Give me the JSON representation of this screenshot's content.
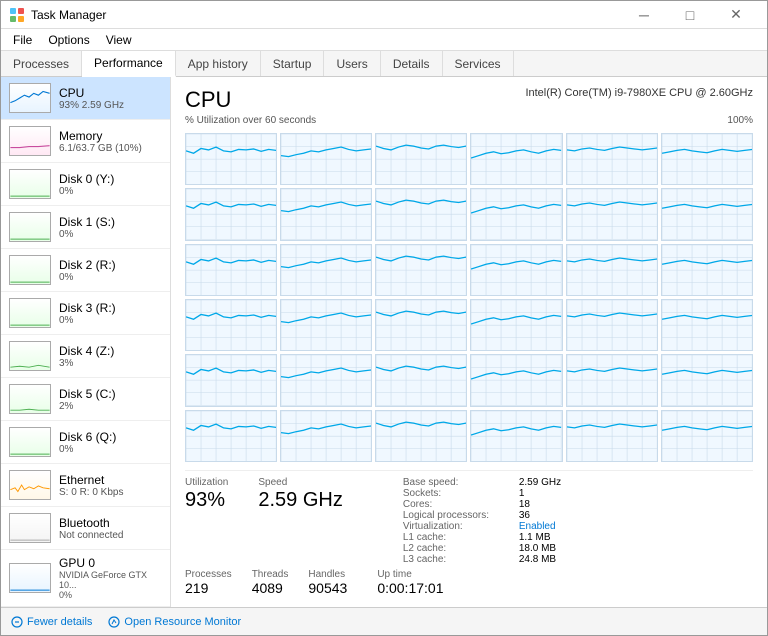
{
  "window": {
    "title": "Task Manager",
    "controls": {
      "minimize": "─",
      "maximize": "□",
      "close": "✕"
    }
  },
  "menu": {
    "items": [
      "File",
      "Options",
      "View"
    ]
  },
  "tabs": {
    "items": [
      "Processes",
      "Performance",
      "App history",
      "Startup",
      "Users",
      "Details",
      "Services"
    ],
    "active": "Performance"
  },
  "sidebar": {
    "items": [
      {
        "name": "CPU",
        "sub": "93%  2.59 GHz",
        "type": "cpu",
        "active": true
      },
      {
        "name": "Memory",
        "sub": "6.1/63.7 GB (10%)",
        "type": "mem",
        "active": false
      },
      {
        "name": "Disk 0 (Y:)",
        "sub": "0%",
        "type": "disk",
        "active": false
      },
      {
        "name": "Disk 1 (S:)",
        "sub": "0%",
        "type": "disk",
        "active": false
      },
      {
        "name": "Disk 2 (R:)",
        "sub": "0%",
        "type": "disk",
        "active": false
      },
      {
        "name": "Disk 3 (R:)",
        "sub": "0%",
        "type": "disk",
        "active": false
      },
      {
        "name": "Disk 4 (Z:)",
        "sub": "3%",
        "type": "disk",
        "active": false
      },
      {
        "name": "Disk 5 (C:)",
        "sub": "2%",
        "type": "disk",
        "active": false
      },
      {
        "name": "Disk 6 (Q:)",
        "sub": "0%",
        "type": "disk",
        "active": false
      },
      {
        "name": "Ethernet",
        "sub": "S: 0 R: 0 Kbps",
        "type": "eth",
        "active": false
      },
      {
        "name": "Bluetooth",
        "sub": "Not connected",
        "type": "bt",
        "active": false
      },
      {
        "name": "GPU 0",
        "sub": "NVIDIA GeForce GTX 10...\n0%",
        "type": "gpu",
        "active": false
      }
    ]
  },
  "main": {
    "title": "CPU",
    "cpu_name": "Intel(R) Core(TM) i9-7980XE CPU @ 2.60GHz",
    "chart_label": "% Utilization over 60 seconds",
    "chart_max": "100%",
    "stats": {
      "utilization_label": "Utilization",
      "utilization_value": "93%",
      "speed_label": "Speed",
      "speed_value": "2.59 GHz",
      "processes_label": "Processes",
      "processes_value": "219",
      "threads_label": "Threads",
      "threads_value": "4089",
      "handles_label": "Handles",
      "handles_value": "90543",
      "uptime_label": "Up time",
      "uptime_value": "0:00:17:01"
    },
    "details": {
      "base_speed_label": "Base speed:",
      "base_speed_value": "2.59 GHz",
      "sockets_label": "Sockets:",
      "sockets_value": "1",
      "cores_label": "Cores:",
      "cores_value": "18",
      "logical_label": "Logical processors:",
      "logical_value": "36",
      "virt_label": "Virtualization:",
      "virt_value": "Enabled",
      "l1_label": "L1 cache:",
      "l1_value": "1.1 MB",
      "l2_label": "L2 cache:",
      "l2_value": "18.0 MB",
      "l3_label": "L3 cache:",
      "l3_value": "24.8 MB"
    }
  },
  "bottom": {
    "fewer_label": "Fewer details",
    "monitor_label": "Open Resource Monitor"
  }
}
